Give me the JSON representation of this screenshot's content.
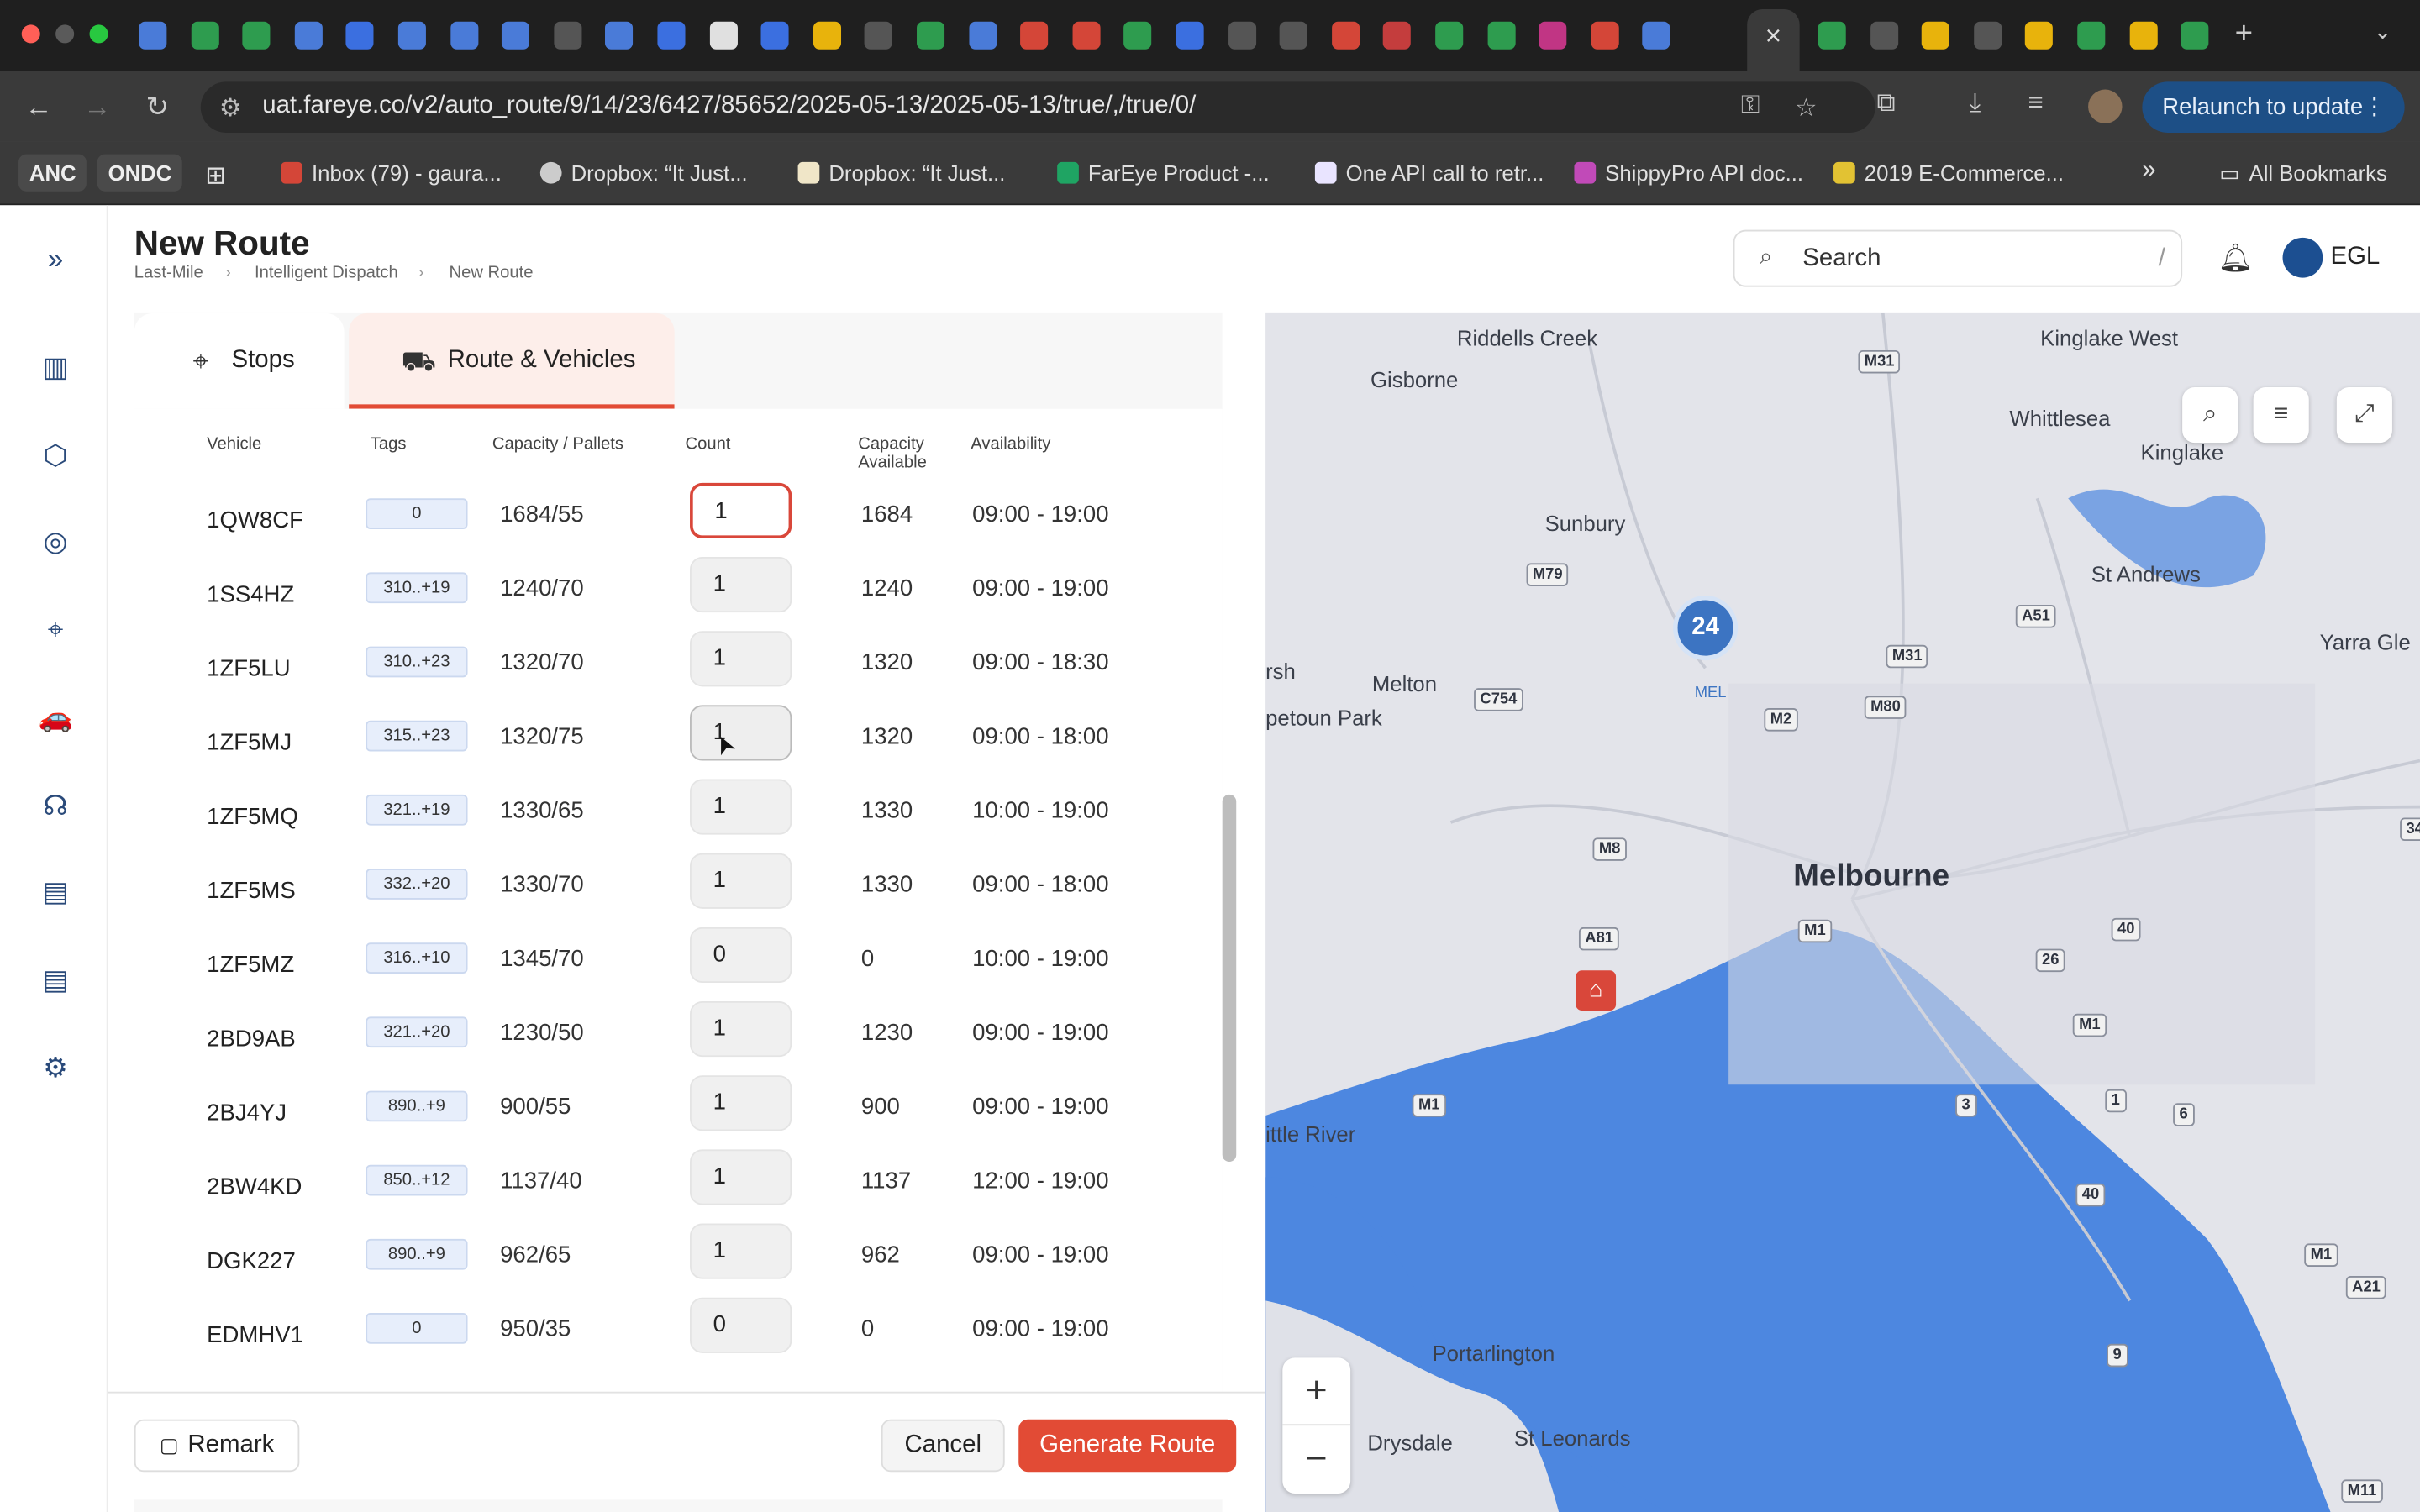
{
  "browser": {
    "active_tab_close": "×",
    "new_tab": "+",
    "url": "uat.fareye.co/v2/auto_route/9/14/23/6427/85652/2025-05-13/2025-05-13/true/,/true/0/",
    "relaunch": "Relaunch to update",
    "bookmarks": {
      "anc": "ANC",
      "ondc": "ONDC",
      "items": [
        "Inbox (79) - gaura...",
        "Dropbox: “It Just...",
        "Dropbox: “It Just...",
        "FarEye Product -...",
        "One API call to retr...",
        "ShippyPro API doc...",
        "2019 E-Commerce..."
      ],
      "more": "»",
      "all": "All Bookmarks"
    }
  },
  "header": {
    "title": "New Route",
    "breadcrumb": [
      "Last-Mile",
      "Intelligent Dispatch",
      "New Route"
    ],
    "search_placeholder": "Search",
    "search_shortcut": "/",
    "user": "EGL"
  },
  "tabs": {
    "stops": "Stops",
    "route": "Route & Vehicles"
  },
  "table": {
    "columns": {
      "vehicle": "Vehicle",
      "tags": "Tags",
      "capacity": "Capacity / Pallets",
      "count": "Count",
      "capacity_available_1": "Capacity",
      "capacity_available_2": "Available",
      "availability": "Availability"
    },
    "rows": [
      {
        "vehicle": "1QW8CF",
        "tags": "0",
        "capacity": "1684/55",
        "count": "1",
        "available": "1684",
        "time": "09:00 - 19:00"
      },
      {
        "vehicle": "1SS4HZ",
        "tags": "310..+19",
        "capacity": "1240/70",
        "count": "1",
        "available": "1240",
        "time": "09:00 - 19:00"
      },
      {
        "vehicle": "1ZF5LU",
        "tags": "310..+23",
        "capacity": "1320/70",
        "count": "1",
        "available": "1320",
        "time": "09:00 - 18:30"
      },
      {
        "vehicle": "1ZF5MJ",
        "tags": "315..+23",
        "capacity": "1320/75",
        "count": "1",
        "available": "1320",
        "time": "09:00 - 18:00"
      },
      {
        "vehicle": "1ZF5MQ",
        "tags": "321..+19",
        "capacity": "1330/65",
        "count": "1",
        "available": "1330",
        "time": "10:00 - 19:00"
      },
      {
        "vehicle": "1ZF5MS",
        "tags": "332..+20",
        "capacity": "1330/70",
        "count": "1",
        "available": "1330",
        "time": "09:00 - 18:00"
      },
      {
        "vehicle": "1ZF5MZ",
        "tags": "316..+10",
        "capacity": "1345/70",
        "count": "0",
        "available": "0",
        "time": "10:00 - 19:00"
      },
      {
        "vehicle": "2BD9AB",
        "tags": "321..+20",
        "capacity": "1230/50",
        "count": "1",
        "available": "1230",
        "time": "09:00 - 19:00"
      },
      {
        "vehicle": "2BJ4YJ",
        "tags": "890..+9",
        "capacity": "900/55",
        "count": "1",
        "available": "900",
        "time": "09:00 - 19:00"
      },
      {
        "vehicle": "2BW4KD",
        "tags": "850..+12",
        "capacity": "1137/40",
        "count": "1",
        "available": "1137",
        "time": "12:00 - 19:00"
      },
      {
        "vehicle": "DGK227",
        "tags": "890..+9",
        "capacity": "962/65",
        "count": "1",
        "available": "962",
        "time": "09:00 - 19:00"
      },
      {
        "vehicle": "EDMHV1",
        "tags": "0",
        "capacity": "950/35",
        "count": "0",
        "available": "0",
        "time": "09:00 - 19:00"
      }
    ]
  },
  "footer": {
    "remark": "Remark",
    "cancel": "Cancel",
    "generate": "Generate Route"
  },
  "map": {
    "cluster_count": "24",
    "places": [
      "Riddells Creek",
      "Kinglake West",
      "Gisborne",
      "Whittlesea",
      "Kinglake",
      "Sunbury",
      "St Andrews",
      "Yarra Gle",
      "rsh",
      "Melton",
      "petoun Park",
      "Melbourne",
      "ittle River",
      "Portarlington",
      "Drysdale",
      "St Leonards",
      "MEL"
    ],
    "roads": [
      "M31",
      "M79",
      "A51",
      "M31",
      "C754",
      "M2",
      "M80",
      "34",
      "M8",
      "M1",
      "40",
      "A81",
      "26",
      "M1",
      "M1",
      "3",
      "1",
      "6",
      "40",
      "A21",
      "M1",
      "9",
      "M11"
    ],
    "zoom_in": "+",
    "zoom_out": "−"
  },
  "colors": {
    "accent": "#e24b35",
    "cluster": "#3c74c2",
    "water": "#4d87e0"
  }
}
